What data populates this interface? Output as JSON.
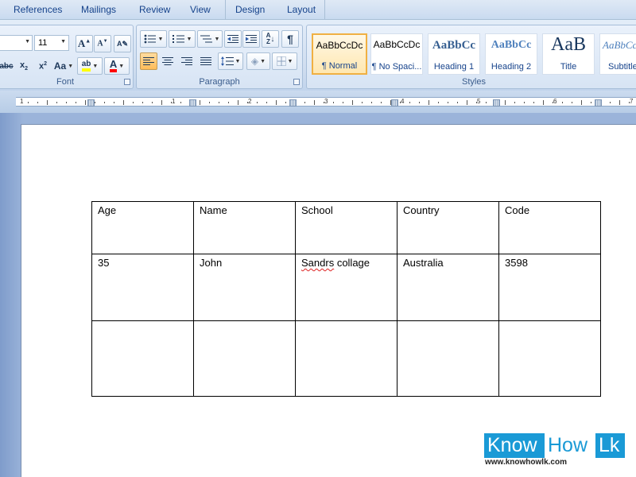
{
  "tabs": [
    "References",
    "Mailings",
    "Review",
    "View",
    "Design",
    "Layout"
  ],
  "font": {
    "size": "11",
    "group_label": "Font"
  },
  "paragraph": {
    "group_label": "Paragraph"
  },
  "styles": {
    "group_label": "Styles",
    "items": [
      {
        "sample": "AaBbCcDc",
        "name": "¶ Normal",
        "selected": true
      },
      {
        "sample": "AaBbCcDc",
        "name": "¶ No Spaci...",
        "selected": false
      },
      {
        "sample": "AaBbCc",
        "name": "Heading 1",
        "selected": false
      },
      {
        "sample": "AaBbCc",
        "name": "Heading 2",
        "selected": false
      },
      {
        "sample": "AaB",
        "name": "Title",
        "selected": false
      },
      {
        "sample": "AaBbCc",
        "name": "Subtitle",
        "selected": false
      }
    ]
  },
  "ruler": {
    "numbers": [
      "1",
      "1",
      "2",
      "3",
      "4",
      "5",
      "6",
      "7"
    ]
  },
  "table": {
    "rows": [
      [
        "Age",
        "Name",
        "School",
        "Country",
        "Code"
      ],
      [
        "35",
        "John",
        "Sandrs collage",
        "Australia",
        "3598"
      ],
      [
        "",
        "",
        "",
        "",
        ""
      ]
    ],
    "misspelled_word": "Sandrs"
  },
  "watermark": {
    "know": "Know",
    "how": "How",
    "lk": "Lk",
    "url": "www.knowhowlk.com"
  },
  "colors": {
    "highlight": "#ffff00",
    "font_color": "#ff0000",
    "watermark_blue": "#1a9ad6"
  }
}
